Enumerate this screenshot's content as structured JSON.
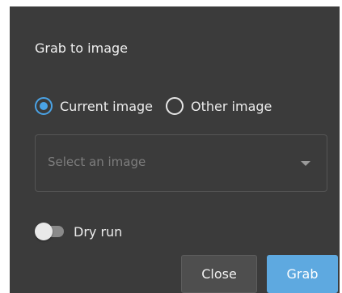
{
  "dialog": {
    "title": "Grab to image",
    "radios": [
      {
        "label": "Current image",
        "checked": true
      },
      {
        "label": "Other image",
        "checked": false
      }
    ],
    "select": {
      "placeholder": "Select an image",
      "icon": "chevron-down-icon"
    },
    "dry_run": {
      "label": "Dry run",
      "enabled": false
    },
    "buttons": {
      "close_label": "Close",
      "grab_label": "Grab"
    },
    "colors": {
      "background": "#3b3b3b",
      "accent": "#4aa3e6",
      "grab_button": "#5ea9e0",
      "close_button": "#4e4e4e"
    }
  }
}
